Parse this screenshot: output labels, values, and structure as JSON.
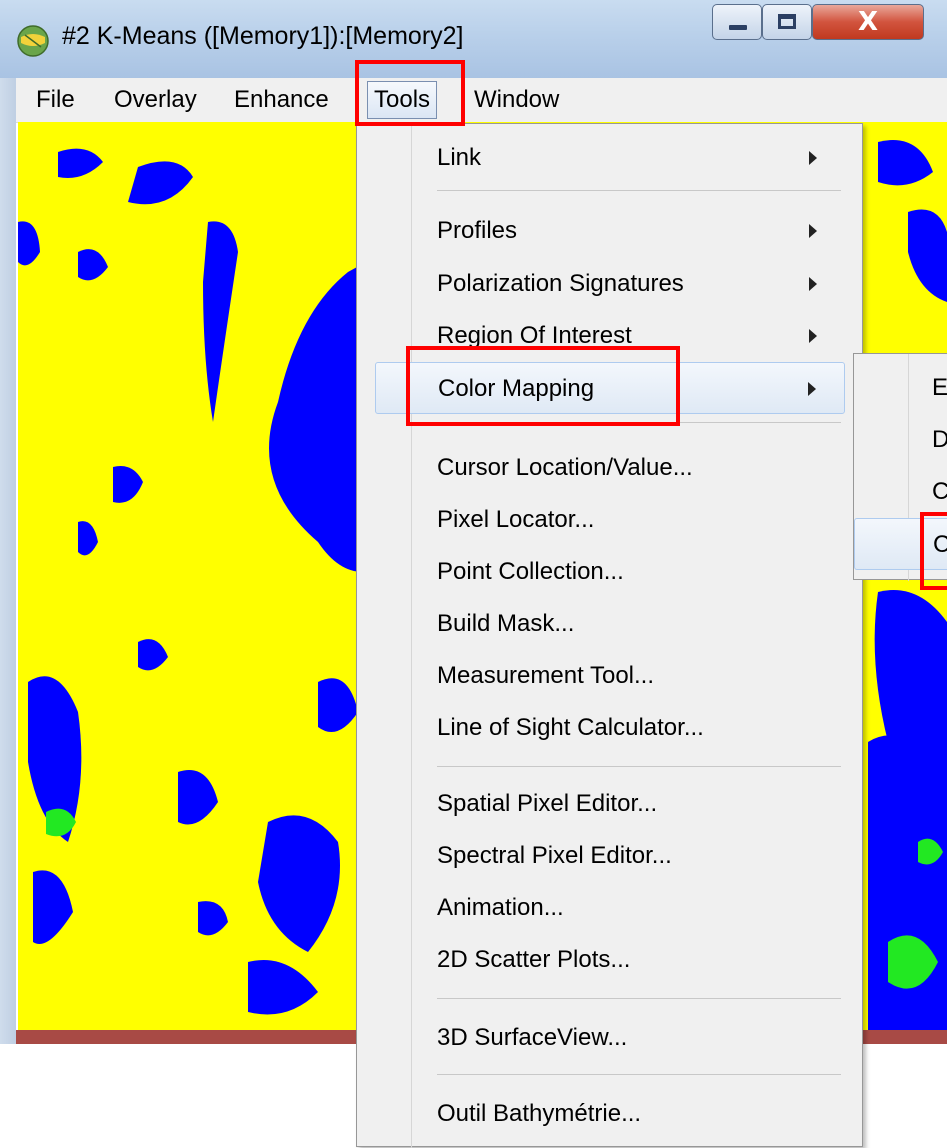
{
  "window": {
    "title": "#2 K-Means ([Memory1]):[Memory2]",
    "close_symbol": "X"
  },
  "menubar": {
    "items": [
      "File",
      "Overlay",
      "Enhance",
      "Tools",
      "Window"
    ],
    "active": "Tools"
  },
  "tools_menu": {
    "items": [
      {
        "label": "Link",
        "submenu": true
      },
      {
        "label": "Profiles",
        "submenu": true
      },
      {
        "label": "Polarization Signatures",
        "submenu": true
      },
      {
        "label": "Region Of Interest",
        "submenu": true
      },
      {
        "label": "Color Mapping",
        "submenu": true,
        "highlighted": true
      },
      {
        "label": "Cursor Location/Value...",
        "submenu": false
      },
      {
        "label": "Pixel Locator...",
        "submenu": false
      },
      {
        "label": "Point Collection...",
        "submenu": false
      },
      {
        "label": "Build Mask...",
        "submenu": false
      },
      {
        "label": "Measurement Tool...",
        "submenu": false
      },
      {
        "label": "Line of Sight Calculator...",
        "submenu": false
      },
      {
        "label": "Spatial Pixel Editor...",
        "submenu": false
      },
      {
        "label": "Spectral Pixel Editor...",
        "submenu": false
      },
      {
        "label": "Animation...",
        "submenu": false
      },
      {
        "label": "2D Scatter Plots...",
        "submenu": false
      },
      {
        "label": "3D SurfaceView...",
        "submenu": false
      },
      {
        "label": "Outil Bathymétrie...",
        "submenu": false
      }
    ]
  },
  "color_mapping_submenu": {
    "items": [
      {
        "label": "E"
      },
      {
        "label": "D"
      },
      {
        "label": "C"
      },
      {
        "label": "C",
        "highlighted": true
      }
    ]
  },
  "colors": {
    "image_background": "#ffff00",
    "class_blue": "#0000ff",
    "class_green": "#22e822",
    "highlight_box": "#ff0000"
  },
  "icons": {
    "app": "envi-app-icon",
    "minimize": "minimize-icon",
    "maximize": "maximize-icon",
    "close": "close-icon",
    "submenu_arrow": "triangle-right-icon"
  }
}
